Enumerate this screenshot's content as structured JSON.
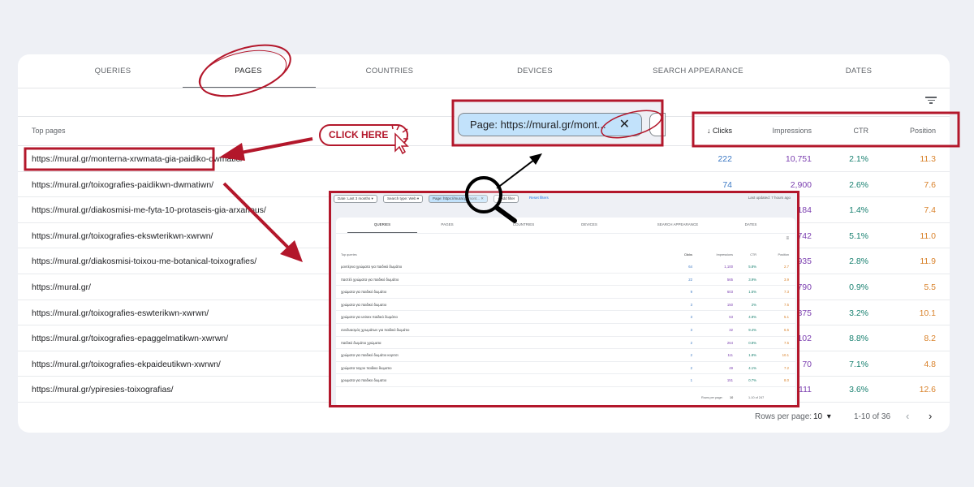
{
  "tabs": [
    "QUERIES",
    "PAGES",
    "COUNTRIES",
    "DEVICES",
    "SEARCH APPEARANCE",
    "DATES"
  ],
  "active_tab": "PAGES",
  "table": {
    "title": "Top pages",
    "columns": [
      "Clicks",
      "Impressions",
      "CTR",
      "Position"
    ],
    "sort_column": "Clicks",
    "rows": [
      [
        "https://mural.gr/monterna-xrwmata-gia-paidiko-dwmatio/",
        "222",
        "10,751",
        "2.1%",
        "11.3"
      ],
      [
        "https://mural.gr/toixografies-paidikwn-dwmatiwn/",
        "74",
        "2,900",
        "2.6%",
        "7.6"
      ],
      [
        "https://mural.gr/diakosmisi-me-fyta-10-protaseis-gia-arxarious/",
        "",
        "184",
        "1.4%",
        "7.4"
      ],
      [
        "https://mural.gr/toixografies-ekswterikwn-xwrwn/",
        "",
        "742",
        "5.1%",
        "11.0"
      ],
      [
        "https://mural.gr/diakosmisi-toixou-me-botanical-toixografies/",
        "",
        "935",
        "2.8%",
        "11.9"
      ],
      [
        "https://mural.gr/",
        "",
        "790",
        "0.9%",
        "5.5"
      ],
      [
        "https://mural.gr/toixografies-eswterikwn-xwrwn/",
        "",
        "375",
        "3.2%",
        "10.1"
      ],
      [
        "https://mural.gr/toixografies-epaggelmatikwn-xwrwn/",
        "",
        "102",
        "8.8%",
        "8.2"
      ],
      [
        "https://mural.gr/toixografies-ekpaideutikwn-xwrwn/",
        "",
        "70",
        "7.1%",
        "4.8"
      ],
      [
        "https://mural.gr/ypiresies-toixografias/",
        "",
        "111",
        "3.6%",
        "12.6"
      ]
    ]
  },
  "pagination": {
    "label": "Rows per page:",
    "value": "10",
    "range": "1-10 of 36"
  },
  "annotations": {
    "click_here": "CLICK HERE",
    "chip": "Page: https://mural.gr/mont...",
    "chip_close": "✕",
    "color": "#b3172b"
  },
  "inset": {
    "filters": [
      "Date: Last 3 months ▾",
      "Search type: Web ▾",
      "Page: https://mural.gr/mont... ✕",
      "+ Add filter"
    ],
    "reset": "Reset filters",
    "updated": "Last updated: 7 hours ago",
    "tabs": [
      "QUERIES",
      "PAGES",
      "COUNTRIES",
      "DEVICES",
      "SEARCH APPEARANCE",
      "DATES"
    ],
    "title": "Top queries",
    "columns": [
      "Clicks",
      "Impressions",
      "CTR",
      "Position"
    ],
    "rows": [
      [
        "μοντέρνα χρώματα για παιδικό δωμάτιο",
        "64",
        "1,100",
        "5.8%",
        "2.7"
      ],
      [
        "παστέλ χρώματα για παιδικό δωμάτιο",
        "22",
        "565",
        "3.9%",
        "3.9"
      ],
      [
        "χρώματα για παιδικό δωμάτιο",
        "9",
        "603",
        "1.5%",
        "7.3"
      ],
      [
        "χρώματα για παιδικό δωματιο",
        "3",
        "150",
        "2%",
        "7.5"
      ],
      [
        "χρώματα για unisex παιδικό δωμάτιο",
        "3",
        "63",
        "4.8%",
        "5.1"
      ],
      [
        "συνδυασμός χρωμάτων για παιδικό δωμάτιο",
        "3",
        "32",
        "9.4%",
        "6.5"
      ],
      [
        "παιδικό δωμάτιο χρώματα",
        "2",
        "264",
        "0.8%",
        "7.5"
      ],
      [
        "χρώματα για παιδικό δωμάτιο κοριτσι",
        "2",
        "111",
        "1.8%",
        "10.1"
      ],
      [
        "χρώματα τοιχου παιδικο δωματιο",
        "2",
        "49",
        "4.1%",
        "7.2"
      ],
      [
        "χρωματα για παιδικο δωματιο",
        "1",
        "151",
        "0.7%",
        "8.0"
      ]
    ],
    "pagination": {
      "label": "Rows per page:",
      "value": "10",
      "range": "1-10 of 247"
    }
  },
  "colors": {
    "clicks": "#3b78c4",
    "impressions": "#7b3fb0",
    "ctr": "#188070",
    "position": "#d9822b"
  }
}
